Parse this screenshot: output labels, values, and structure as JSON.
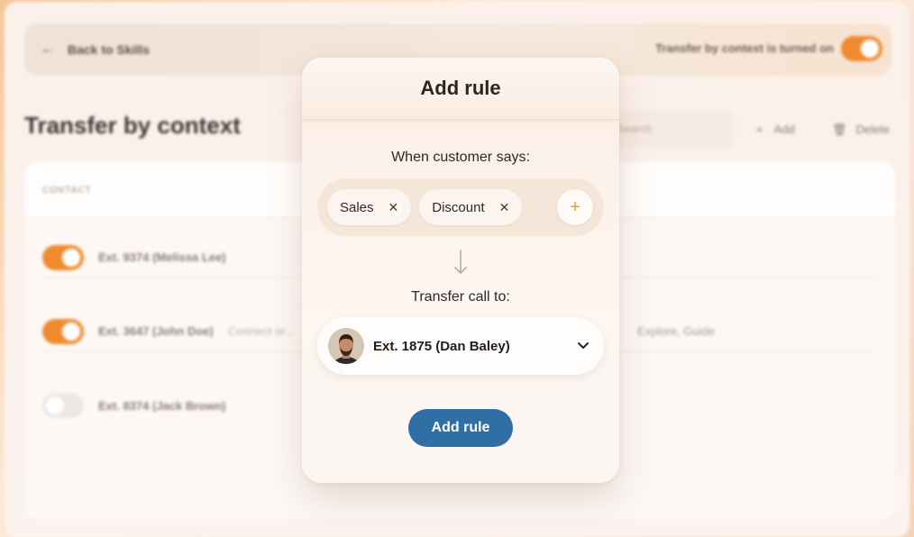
{
  "background": {
    "back_label": "Back to Skills",
    "toggle_status": "Transfer by context is turned on",
    "page_title": "Transfer by context",
    "search_placeholder": "Search",
    "add_label": "Add",
    "delete_label": "Delete",
    "table_header": "CONTACT",
    "rows": [
      {
        "label": "Ext. 9374 (Melissa Lee)",
        "extra": "",
        "right": "",
        "enabled": true
      },
      {
        "label": "Ext. 3647 (John Doe)",
        "extra": "Connect or...",
        "right": "Explore, Guide",
        "enabled": true
      },
      {
        "label": "Ext. 8374 (Jack Brown)",
        "extra": "",
        "right": "",
        "enabled": false
      }
    ]
  },
  "modal": {
    "title": "Add rule",
    "when_label": "When customer says:",
    "chips": [
      "Sales",
      "Discount"
    ],
    "add_chip_symbol": "+",
    "transfer_label": "Transfer call to:",
    "selected_contact": "Ext. 1875 (Dan Baley)",
    "submit_label": "Add rule"
  },
  "colors": {
    "accent_orange": "#f08a2e",
    "primary_blue": "#2f6fa6"
  },
  "icons": {
    "back": "arrow-left-icon",
    "chip_remove": "close-icon",
    "add_chip": "plus-icon",
    "flow": "arrow-down-icon",
    "dropdown": "chevron-down-icon",
    "add_action": "plus-icon",
    "delete_action": "trash-icon"
  }
}
